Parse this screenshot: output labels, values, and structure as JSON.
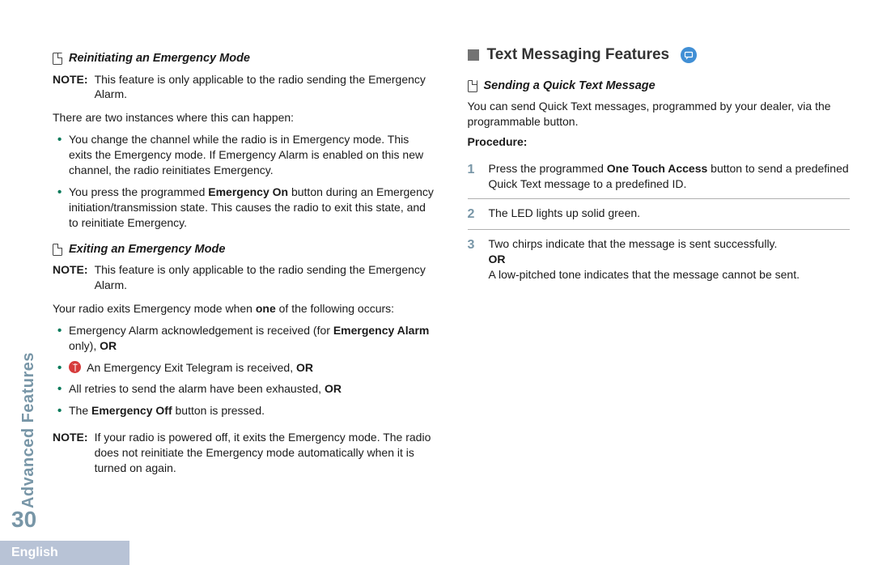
{
  "page_number": "30",
  "side_label": "Advanced Features",
  "language": "English",
  "left": {
    "sub1": {
      "title": "Reinitiating an Emergency Mode",
      "note_label": "NOTE:",
      "note_text": "This feature is only applicable to the radio sending the Emergency Alarm.",
      "intro": "There are two instances where this can happen:",
      "b1": "You change the channel while the radio is in Emergency mode. This exits the Emergency mode. If Emergency Alarm is enabled on this new channel, the radio reinitiates Emergency.",
      "b2_a": "You press the programmed ",
      "b2_bold": "Emergency On",
      "b2_b": " button during an Emergency initiation/transmission state. This causes the radio to exit this state, and to reinitiate Emergency."
    },
    "sub2": {
      "title": "Exiting an Emergency Mode",
      "note_label": "NOTE:",
      "note_text": "This feature is only applicable to the radio sending the Emergency Alarm.",
      "intro_a": "Your radio exits Emergency mode when ",
      "intro_bold": "one",
      "intro_b": " of the following occurs:",
      "b1_a": "Emergency Alarm acknowledgement is received (for ",
      "b1_bold": "Emergency Alarm",
      "b1_b": " only), ",
      "b1_or": "OR",
      "b2_a": " An Emergency Exit Telegram is received, ",
      "b2_or": "OR",
      "b3_a": "All retries to send the alarm have been exhausted, ",
      "b3_or": "OR",
      "b4_a": "The ",
      "b4_bold": "Emergency Off",
      "b4_b": " button is pressed.",
      "note2_label": "NOTE:",
      "note2_text": "If your radio is powered off, it exits the Emergency mode. The radio does not reinitiate the Emergency mode automatically when it is turned on again."
    }
  },
  "right": {
    "section_title": "Text Messaging Features",
    "sub": {
      "title": "Sending a Quick Text Message",
      "intro": "You can send Quick Text messages, programmed by your dealer, via the programmable button.",
      "proc_label": "Procedure:",
      "s1_a": "Press the programmed ",
      "s1_bold": "One Touch Access",
      "s1_b": " button to send a predefined Quick Text message to a predefined ID.",
      "s2": "The LED lights up solid green.",
      "s3_a": "Two chirps indicate that the message is sent successfully.",
      "s3_or": "OR",
      "s3_b": "A low-pitched tone indicates that the message cannot be sent.",
      "n1": "1",
      "n2": "2",
      "n3": "3"
    }
  }
}
